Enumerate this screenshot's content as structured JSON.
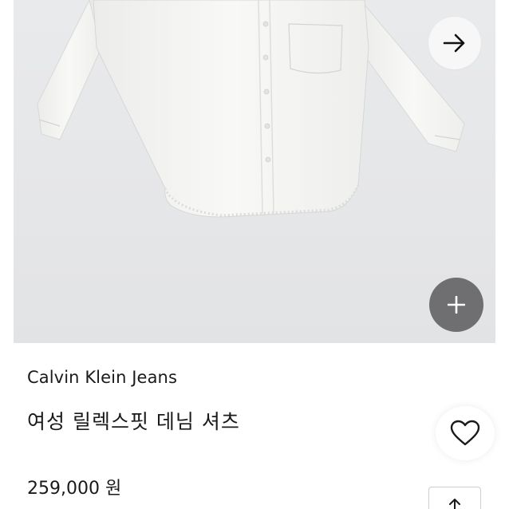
{
  "product": {
    "brand": "Calvin Klein Jeans",
    "name": "여성 릴렉스핏 데님 셔츠",
    "price": "259,000 원"
  },
  "icons": {
    "next": "arrow-right-icon",
    "add": "plus-icon",
    "wishlist": "heart-icon",
    "share": "share-icon"
  },
  "colors": {
    "image_background": "#e6e7e9",
    "shirt": "#f6f6f4",
    "add_button": "#6f6f71",
    "text": "#1a1a1a"
  }
}
